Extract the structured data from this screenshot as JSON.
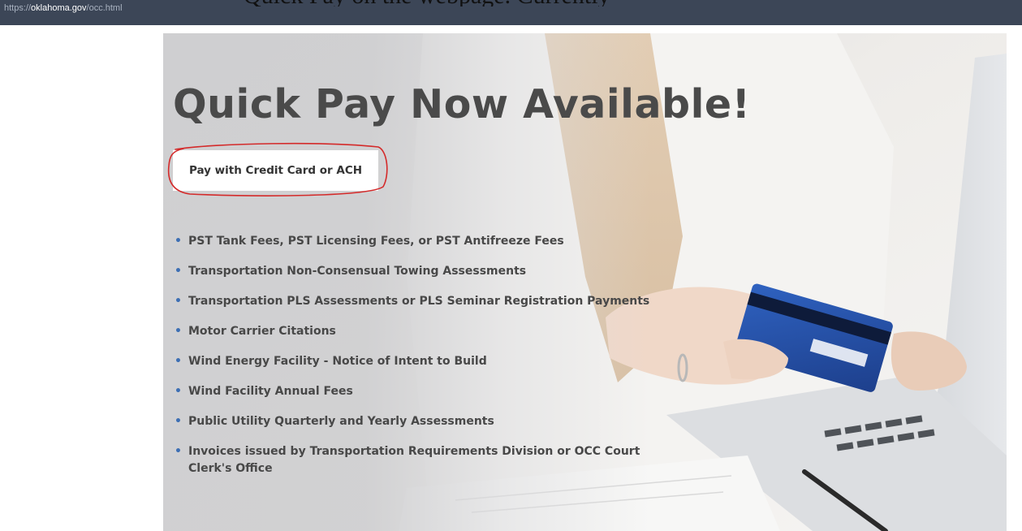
{
  "browser": {
    "url_scheme": "https://",
    "url_host": "oklahoma.gov",
    "url_path": "/occ.html"
  },
  "clipped_header": "Quick Pay on the webpage. Currently",
  "hero": {
    "title": "Quick Pay Now Available!",
    "pay_button_label": "Pay with Credit Card or ACH",
    "items": [
      "PST Tank Fees, PST Licensing Fees, or PST Antifreeze Fees",
      "Transportation Non-Consensual Towing Assessments",
      "Transportation PLS Assessments or PLS Seminar Registration Payments",
      "Motor Carrier Citations",
      "Wind Energy Facility - Notice of Intent to Build",
      "Wind Facility Annual Fees",
      "Public Utility Quarterly and Yearly Assessments",
      "Invoices issued by Transportation Requirements Division or OCC Court Clerk's Office"
    ]
  },
  "colors": {
    "url_bar": "#3c4657",
    "title": "#4a4a4a",
    "bullet": "#3d6fb4",
    "highlight_ring": "#d42a2a"
  },
  "icons": {
    "bullet": "bullet-dot-icon"
  }
}
